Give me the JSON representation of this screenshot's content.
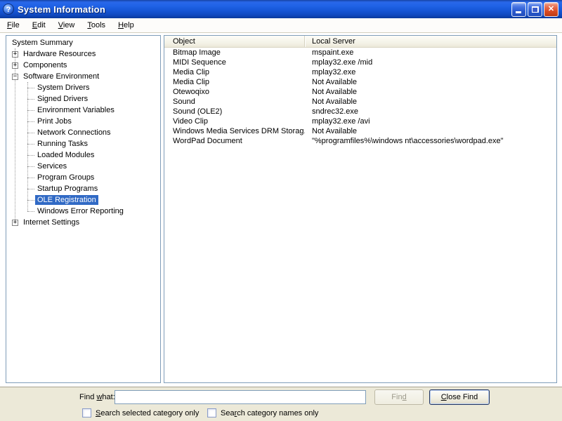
{
  "window": {
    "title": "System Information"
  },
  "icons": {
    "question": "?",
    "plus": "+",
    "minus": "−",
    "close": "✕"
  },
  "menu": {
    "items": [
      {
        "label": "File",
        "accel": 0
      },
      {
        "label": "Edit",
        "accel": 0
      },
      {
        "label": "View",
        "accel": 0
      },
      {
        "label": "Tools",
        "accel": 0
      },
      {
        "label": "Help",
        "accel": 0
      }
    ]
  },
  "tree": {
    "items": [
      {
        "label": "System Summary"
      },
      {
        "label": "Hardware Resources"
      },
      {
        "label": "Components"
      },
      {
        "label": "Software Environment"
      },
      {
        "label": "System Drivers"
      },
      {
        "label": "Signed Drivers"
      },
      {
        "label": "Environment Variables"
      },
      {
        "label": "Print Jobs"
      },
      {
        "label": "Network Connections"
      },
      {
        "label": "Running Tasks"
      },
      {
        "label": "Loaded Modules"
      },
      {
        "label": "Services"
      },
      {
        "label": "Program Groups"
      },
      {
        "label": "Startup Programs"
      },
      {
        "label": "OLE Registration",
        "selected": true
      },
      {
        "label": "Windows Error Reporting"
      },
      {
        "label": "Internet Settings"
      }
    ]
  },
  "list": {
    "columns": [
      "Object",
      "Local Server"
    ],
    "rows": [
      [
        "Bitmap Image",
        "mspaint.exe"
      ],
      [
        "MIDI Sequence",
        "mplay32.exe /mid"
      ],
      [
        "Media Clip",
        "mplay32.exe"
      ],
      [
        "Media Clip",
        "Not Available"
      ],
      [
        "Otewoqixo",
        "Not Available"
      ],
      [
        "Sound",
        "Not Available"
      ],
      [
        "Sound (OLE2)",
        "sndrec32.exe"
      ],
      [
        "Video Clip",
        "mplay32.exe /avi"
      ],
      [
        "Windows Media Services DRM Storag...",
        "Not Available"
      ],
      [
        "WordPad Document",
        "\"%programfiles%\\windows nt\\accessories\\wordpad.exe\""
      ]
    ]
  },
  "find": {
    "label": {
      "label": "Find what:",
      "accel": 5
    },
    "input_value": "",
    "find_button": {
      "label": "Find",
      "accel": 3
    },
    "close_button": {
      "label": "Close Find",
      "accel": 0
    },
    "checkbox1": {
      "label": "Search selected category only",
      "accel": 0,
      "checked": false
    },
    "checkbox2": {
      "label": "Search category names only",
      "accel": 3,
      "checked": false
    }
  },
  "colors": {
    "titlebar_blue": "#1656d6",
    "selection_blue": "#316ac5",
    "panel_border": "#7f9db9",
    "face_beige": "#ece9d8",
    "close_red": "#d94a22"
  }
}
